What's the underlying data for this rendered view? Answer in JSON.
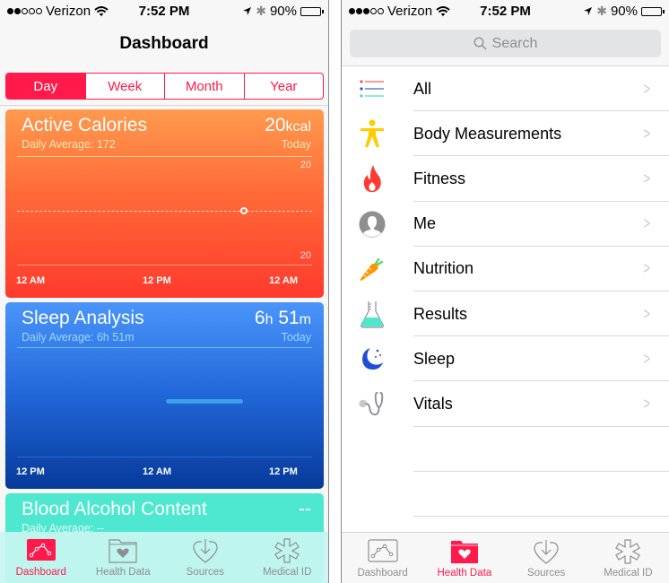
{
  "status_bar_left": {
    "carrier": "Verizon",
    "signal_full": 2,
    "signal_total": 5,
    "time": "7:52 PM",
    "battery": "90%"
  },
  "status_bar_right": {
    "carrier": "Verizon",
    "signal_full": 3,
    "signal_total": 5,
    "time": "7:52 PM",
    "battery": "90%"
  },
  "dashboard": {
    "title": "Dashboard",
    "segments": [
      {
        "label": "Day",
        "active": true
      },
      {
        "label": "Week",
        "active": false
      },
      {
        "label": "Month",
        "active": false
      },
      {
        "label": "Year",
        "active": false
      }
    ],
    "cards": {
      "calories": {
        "title": "Active Calories",
        "daily_average": "Daily Average: 172",
        "value": "20",
        "unit": "kcal",
        "period": "Today",
        "y_top": "20",
        "y_bottom": "20",
        "x_labels": [
          "12 AM",
          "12 PM",
          "12 AM"
        ],
        "point_position_fraction": 0.77
      },
      "sleep": {
        "title": "Sleep Analysis",
        "daily_average": "Daily Average: 6h 51m",
        "value_hours": "6",
        "unit_hours": "h",
        "value_minutes": "51",
        "unit_minutes": "m",
        "period": "Today",
        "x_labels": [
          "12 PM",
          "12 AM",
          "12 PM"
        ]
      },
      "alcohol": {
        "title": "Blood Alcohol Content",
        "daily_average": "Daily Average: --",
        "value": "--"
      }
    }
  },
  "health_data": {
    "search_placeholder": "Search",
    "categories": [
      {
        "label": "All",
        "icon": "list-icon"
      },
      {
        "label": "Body Measurements",
        "icon": "body-icon"
      },
      {
        "label": "Fitness",
        "icon": "flame-icon"
      },
      {
        "label": "Me",
        "icon": "person-icon"
      },
      {
        "label": "Nutrition",
        "icon": "carrot-icon"
      },
      {
        "label": "Results",
        "icon": "flask-icon"
      },
      {
        "label": "Sleep",
        "icon": "moon-icon"
      },
      {
        "label": "Vitals",
        "icon": "stethoscope-icon"
      }
    ]
  },
  "tab_bar": {
    "tabs": [
      {
        "label": "Dashboard",
        "icon": "dashboard-icon"
      },
      {
        "label": "Health Data",
        "icon": "health-data-icon"
      },
      {
        "label": "Sources",
        "icon": "sources-icon"
      },
      {
        "label": "Medical ID",
        "icon": "medical-id-icon"
      }
    ],
    "active_left": "Dashboard",
    "active_right": "Health Data"
  },
  "colors": {
    "accent": "#ff1a4b",
    "calories_top": "#ff9a4e",
    "calories_bottom": "#ff3a2d",
    "sleep_top": "#4a95fa",
    "sleep_bottom": "#063a9a",
    "alcohol": "#4de8cf"
  }
}
